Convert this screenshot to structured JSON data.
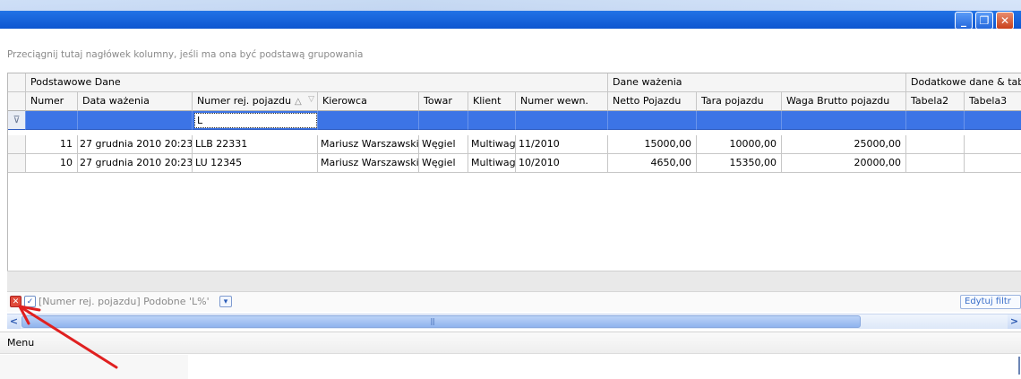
{
  "group_hint": "Przeciągnij tutaj nagłówek kolumny, jeśli ma ona być podstawą grupowania",
  "bands": [
    {
      "id": "podstawowe",
      "label": "Podstawowe Dane"
    },
    {
      "id": "wazenie",
      "label": "Dane ważenia"
    },
    {
      "id": "dodatkowe",
      "label": "Dodatkowe dane & tabe"
    }
  ],
  "columns": [
    {
      "id": "numer",
      "label": "Numer"
    },
    {
      "id": "data",
      "label": "Data ważenia"
    },
    {
      "id": "rej",
      "label": "Numer rej. pojazdu",
      "sort_mark": "△"
    },
    {
      "id": "kierowca",
      "label": "Kierowca"
    },
    {
      "id": "towar",
      "label": "Towar"
    },
    {
      "id": "klient",
      "label": "Klient"
    },
    {
      "id": "wewn",
      "label": "Numer wewn."
    },
    {
      "id": "netto",
      "label": "Netto Pojazdu"
    },
    {
      "id": "tara",
      "label": "Tara pojazdu"
    },
    {
      "id": "brutto",
      "label": "Waga Brutto pojazdu"
    },
    {
      "id": "tabela2",
      "label": "Tabela2"
    },
    {
      "id": "tabela3",
      "label": "Tabela3"
    }
  ],
  "filter_row": {
    "rej": "L"
  },
  "rows": [
    {
      "numer": "11",
      "data": "27 grudnia 2010 20:23",
      "rej": "LLB 22331",
      "kierowca": "Mariusz Warszawski",
      "towar": "Węgiel",
      "klient": "Multiwag",
      "wewn": "11/2010",
      "netto": "15000,00",
      "tara": "10000,00",
      "brutto": "25000,00",
      "tabela2": "",
      "tabela3": ""
    },
    {
      "numer": "10",
      "data": "27 grudnia 2010 20:23",
      "rej": "LU 12345",
      "kierowca": "Mariusz Warszawski",
      "towar": "Węgiel",
      "klient": "Multiwag",
      "wewn": "10/2010",
      "netto": "4650,00",
      "tara": "15350,00",
      "brutto": "20000,00",
      "tabela2": "",
      "tabela3": ""
    }
  ],
  "filter_panel": {
    "text": "[Numer rej. pojazdu] Podobne 'L%'",
    "edit_button": "Edytuj filtr"
  },
  "menu": {
    "label": "Menu"
  },
  "icons": {
    "minimize": "minimize-icon",
    "restore": "restore-icon",
    "close": "close-icon",
    "filter_row": "funnel-icon",
    "clear_filter": "clear-filter-icon",
    "enable_filter": "checkbox-icon",
    "dropdown": "chevron-down-icon",
    "scroll_left": "chevron-left-icon",
    "scroll_right": "chevron-right-icon"
  },
  "colors": {
    "titlebar": "#1f6fe3",
    "filter_row": "#3c74e6",
    "annotation_arrow": "#e02020"
  }
}
